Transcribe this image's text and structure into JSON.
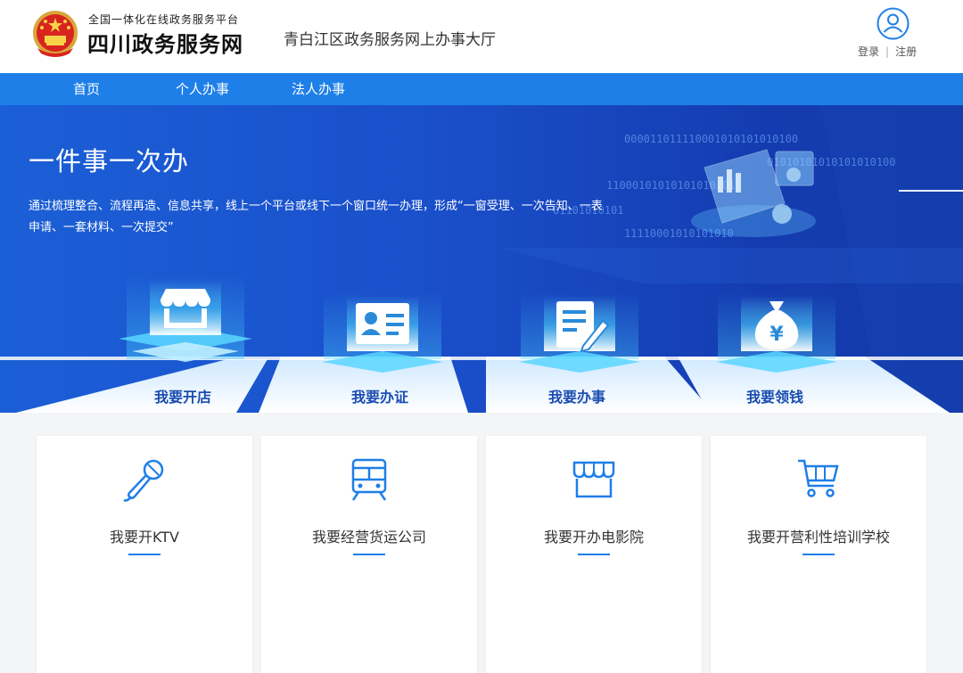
{
  "header": {
    "platform_name": "全国一体化在线政务服务平台",
    "site_name": "四川政务服务网",
    "hall_title": "青白江区政务服务网上办事大厅",
    "login_label": "登录",
    "separator": "|",
    "register_label": "注册"
  },
  "nav": {
    "items": [
      {
        "label": "首页"
      },
      {
        "label": "个人办事"
      },
      {
        "label": "法人办事"
      }
    ]
  },
  "banner": {
    "title": "一件事一次办",
    "description": "通过梳理整合、流程再造、信息共享，线上一个平台或线下一个窗口统一办理，形成“一窗受理、一次告知、一表申请、一套材料、一次提交”",
    "binary_lines": [
      "000011011110001010101010100",
      "01010101010101010100",
      "11000101010101010101",
      "01101010101",
      "11110001010101010"
    ],
    "categories": [
      {
        "label": "我要开店",
        "icon": "shop-icon"
      },
      {
        "label": "我要办证",
        "icon": "id-card-icon"
      },
      {
        "label": "我要办事",
        "icon": "form-edit-icon"
      },
      {
        "label": "我要领钱",
        "icon": "money-bag-icon"
      }
    ]
  },
  "cards": [
    {
      "label": "我要开KTV",
      "icon": "microphone-icon"
    },
    {
      "label": "我要经营货运公司",
      "icon": "train-icon"
    },
    {
      "label": "我要开办电影院",
      "icon": "storefront-icon"
    },
    {
      "label": "我要开营利性培训学校",
      "icon": "cart-icon"
    }
  ],
  "colors": {
    "nav_blue": "#1e7fe8",
    "banner_blue": "#1a4fca",
    "accent": "#1e7fe8",
    "category_text": "#1a4db0"
  }
}
